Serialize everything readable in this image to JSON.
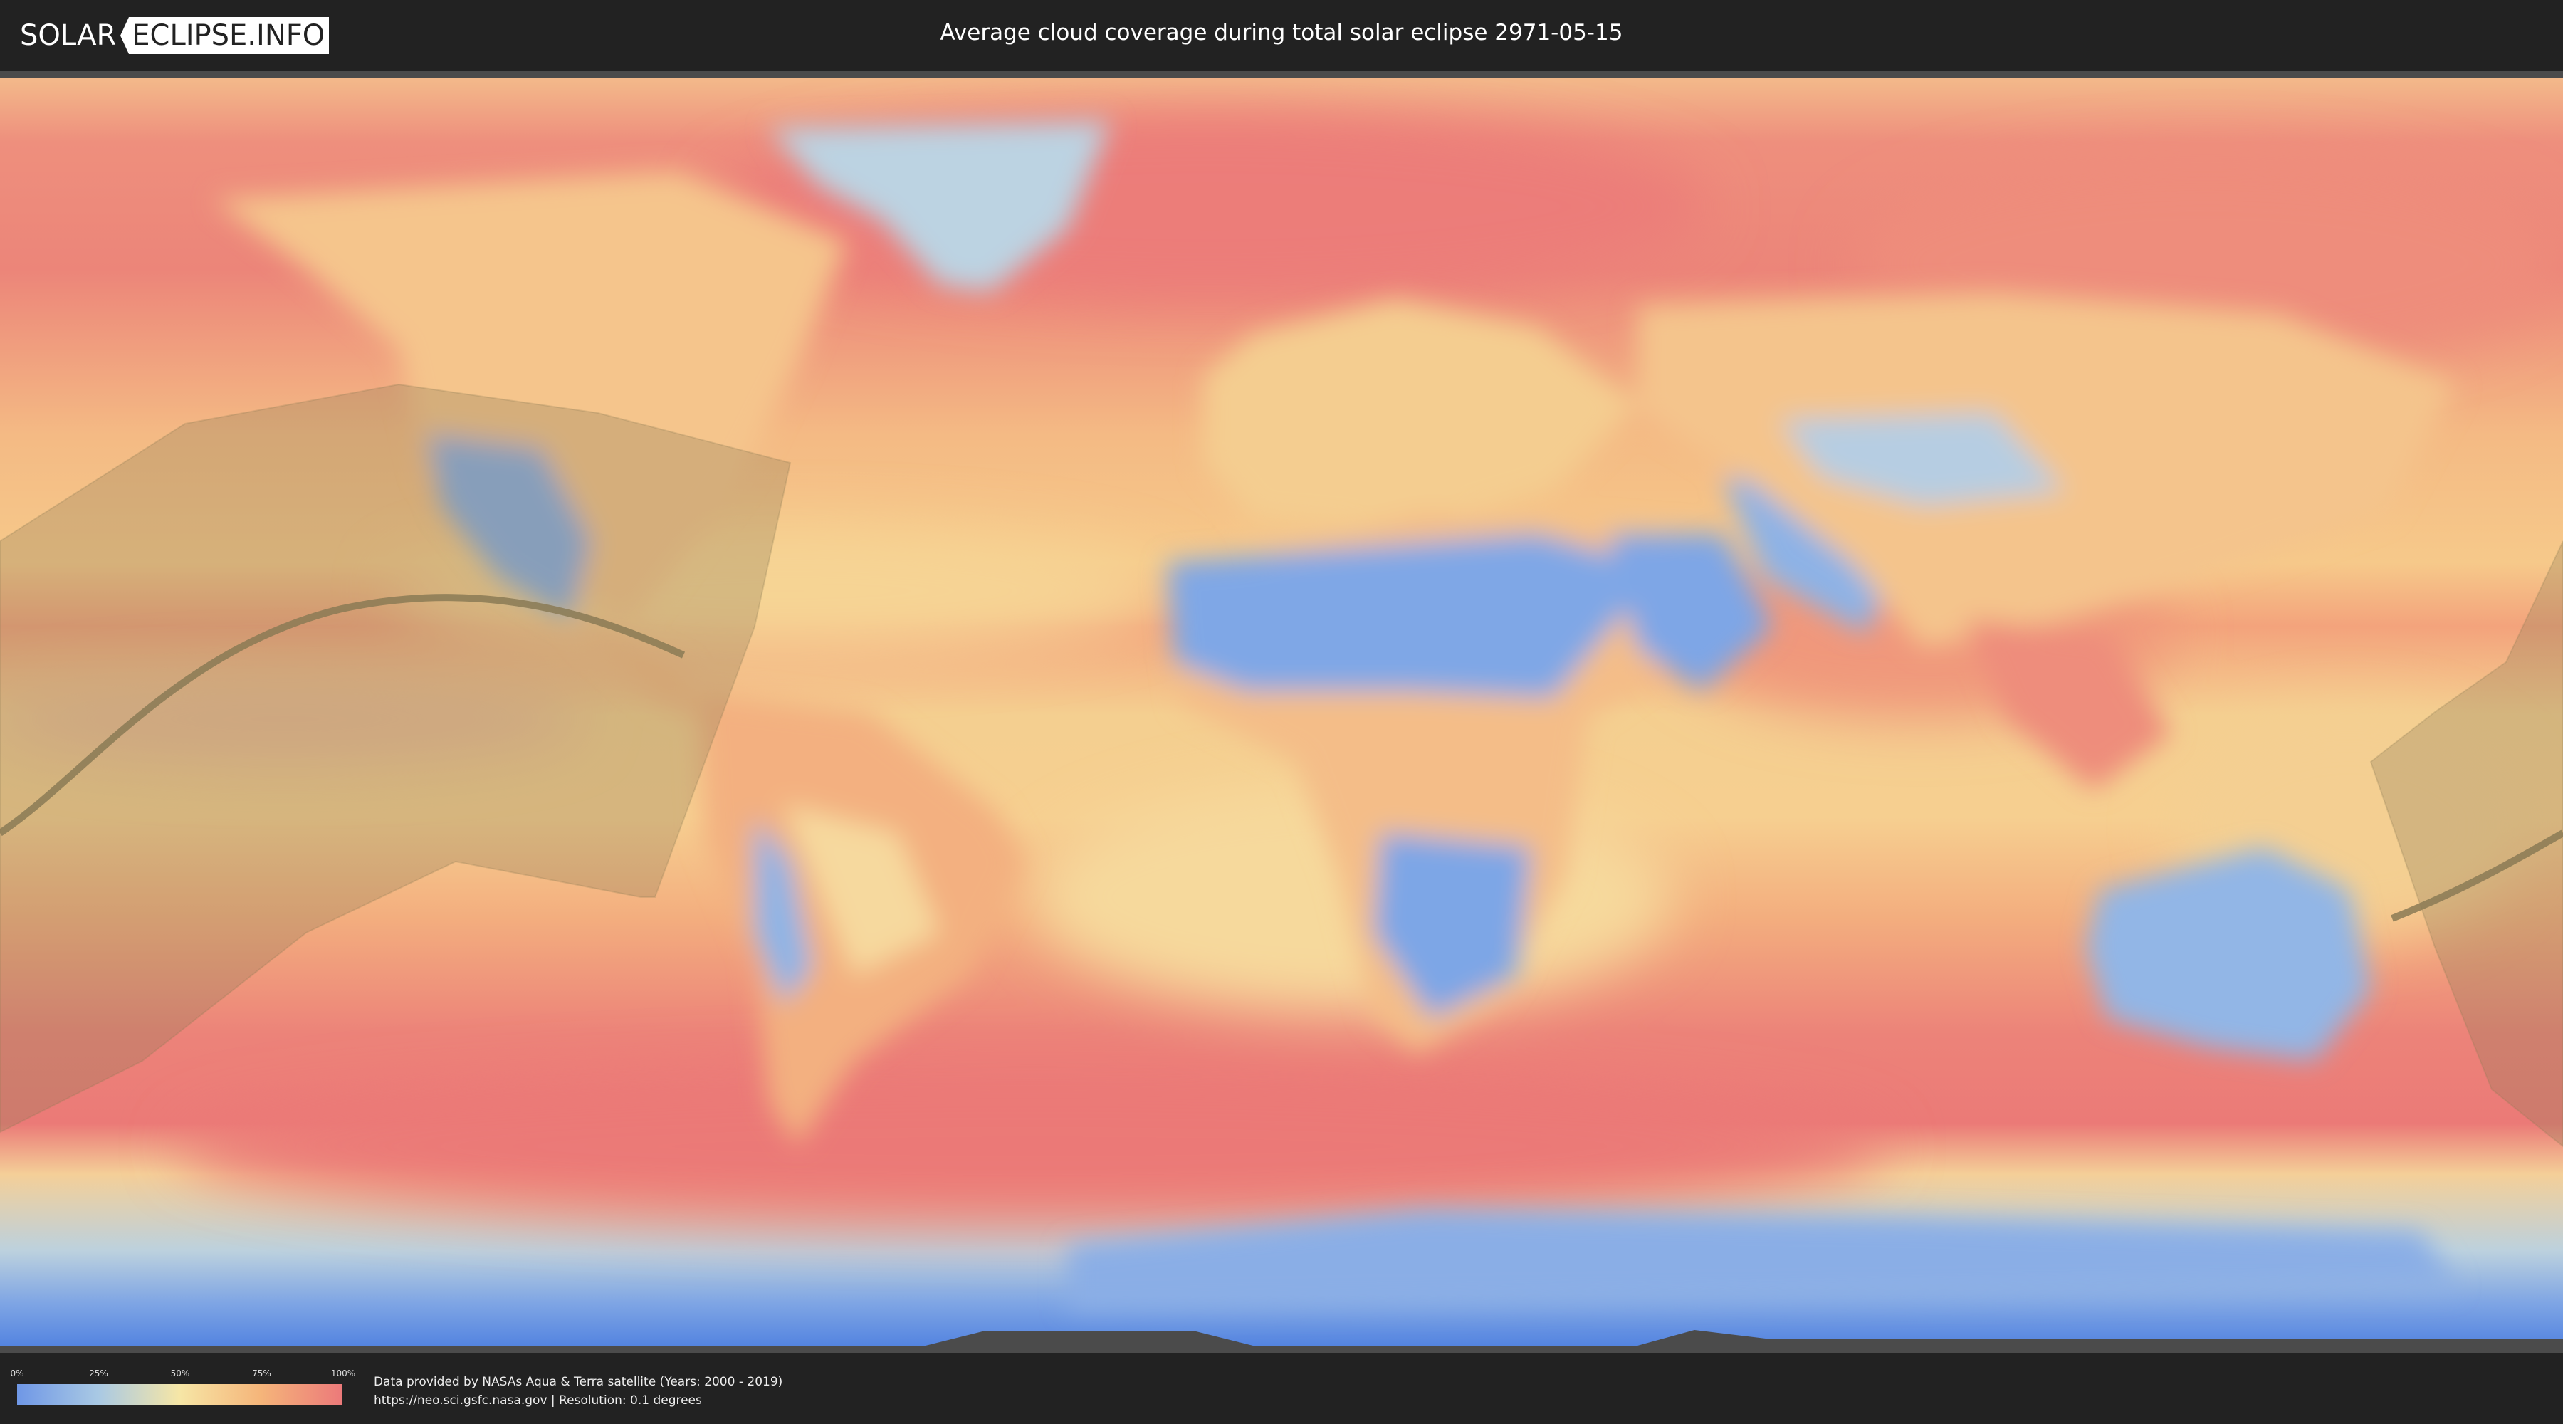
{
  "header": {
    "logo_left": "SOLAR",
    "logo_right": "ECLIPSE.INFO",
    "title": "Average cloud coverage during total solar eclipse 2971-05-15"
  },
  "legend": {
    "ticks": [
      "0%",
      "25%",
      "50%",
      "75%",
      "100%"
    ],
    "scale_values": [
      0,
      25,
      50,
      75,
      100
    ],
    "colors": [
      "#6f97e6",
      "#a9c9e4",
      "#f6e6a6",
      "#f5b57a",
      "#ec7a7a"
    ]
  },
  "attribution": {
    "line1": "Data provided by NASAs Aqua & Terra satellite (Years: 2000 - 2019)",
    "line2": "https://neo.sci.gsfc.nasa.gov | Resolution: 0.1 degrees"
  },
  "map": {
    "projection": "equirectangular",
    "layer": "cloud-coverage",
    "eclipse_path_color": "#8a7a55",
    "colors": {
      "ocean_high_cloud": "#ec7f7a",
      "mid_cloud": "#f6c98c",
      "low_cloud": "#f3e2a4",
      "clear": "#7da4e6",
      "polar": "#5b87e4"
    }
  }
}
